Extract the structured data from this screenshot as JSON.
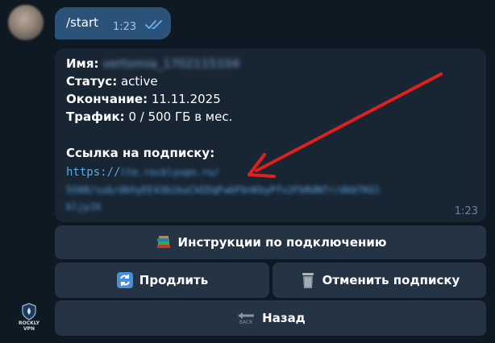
{
  "chat": {
    "outgoing": {
      "text": "/start",
      "time": "1:23"
    },
    "incoming": {
      "name_label": "Имя:",
      "name_value": "vertomia_1702115104",
      "status_label": "Статус:",
      "status_value": "active",
      "expiry_label": "Окончание:",
      "expiry_value": "11.11.2025",
      "traffic_label": "Трафик:",
      "traffic_value": "0 / 500 ГБ в мес.",
      "link_label": "Ссылка на подписку:",
      "link_visible": "https://",
      "link_hidden_1": "lte.rocklyvpn.ru/",
      "link_hidden_2": "5500/sub/dkhyEE43b1kuCkEDqFwbFbnKbyPfv2FbRdNfr/dkbTKGl",
      "link_hidden_3": "kljyJX",
      "time": "1:23"
    }
  },
  "keyboard": {
    "instructions_label": "Инструкции по подключению",
    "renew_label": "Продлить",
    "cancel_label": "Отменить подписку",
    "back_label": "Назад",
    "back_icon_text": "BACK"
  },
  "bot": {
    "avatar_line1": "ROCKLY",
    "avatar_line2": "VPN"
  },
  "colors": {
    "background": "#0f1923",
    "outgoing_bubble": "#2b5278",
    "incoming_bubble": "#182533",
    "button": "#253444",
    "link": "#5aa8e6",
    "annotation_arrow": "#e0201c"
  },
  "icons": {
    "instructions": "books-icon",
    "renew": "refresh-icon",
    "cancel": "trash-icon",
    "back": "back-arrow-icon",
    "read_status": "double-check-icon"
  }
}
